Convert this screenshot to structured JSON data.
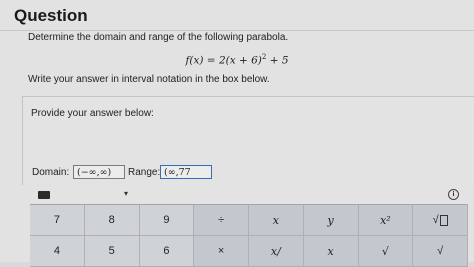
{
  "question": {
    "heading": "Question",
    "prompt": "Determine the domain and range of the following parabola.",
    "formula_parts": {
      "lhs": "f(x) = 2(x + 6)",
      "exponent": "2",
      "rhs": " + 5"
    },
    "instruction": "Write your answer in interval notation in the box below."
  },
  "answer": {
    "prompt": "Provide your answer below:",
    "domain_label": "Domain:",
    "domain_value": "(−∞,∞)",
    "range_label": "Range:",
    "range_value": "(∞,77"
  },
  "keyboard": {
    "caret": "▾",
    "info": "i",
    "row1": [
      "7",
      "8",
      "9",
      "÷",
      "x",
      "y",
      "x²",
      "√"
    ],
    "row2": [
      "4",
      "5",
      "6",
      "×",
      "x/",
      "x",
      "√",
      "√"
    ]
  }
}
